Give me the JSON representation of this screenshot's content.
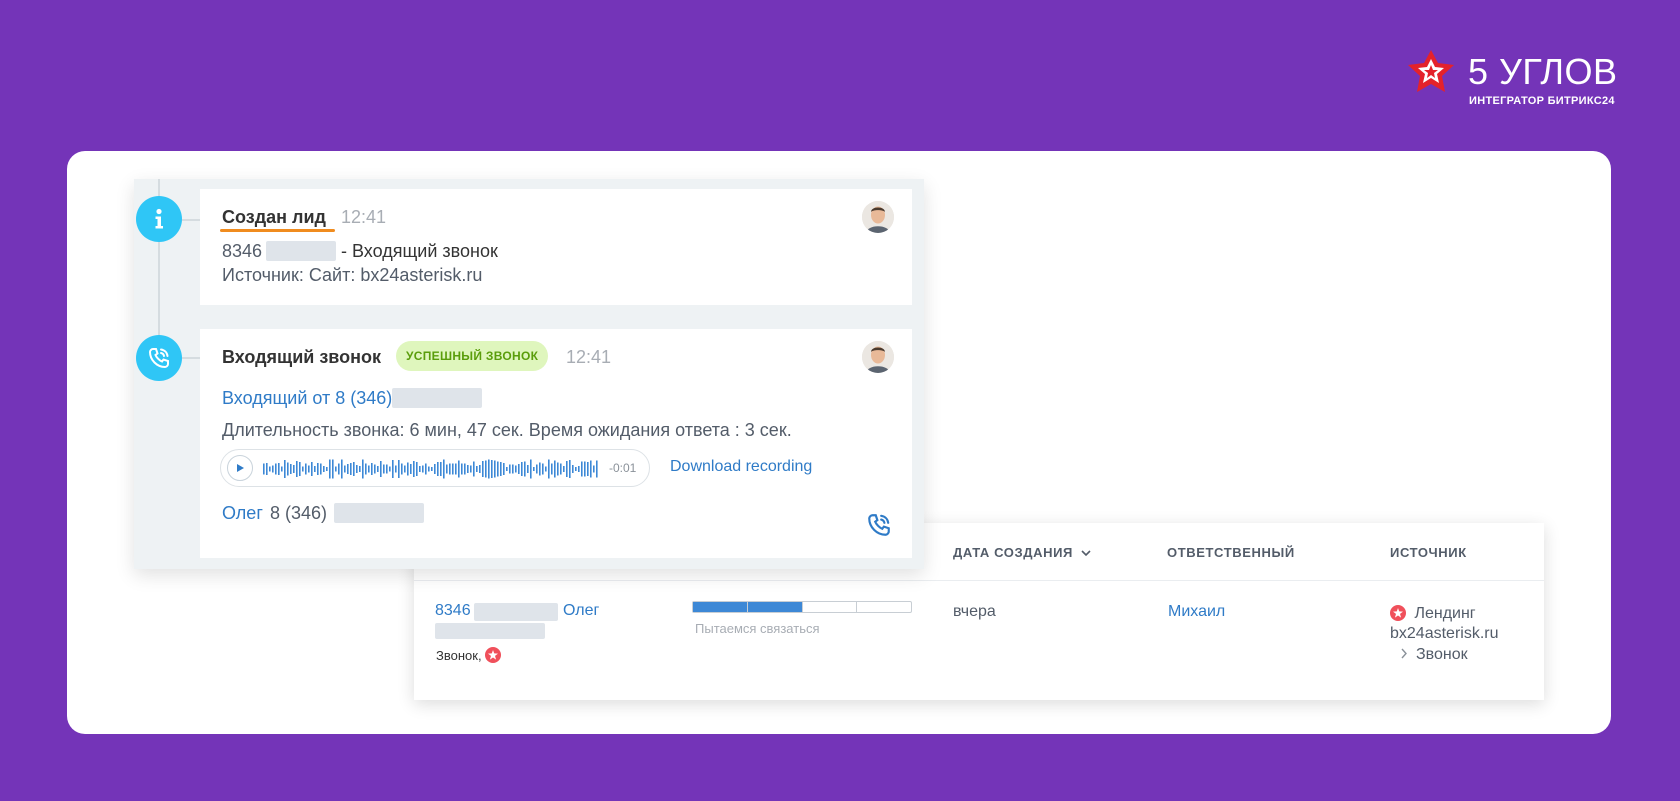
{
  "brand": {
    "name": "5 УГЛОВ",
    "subtitle": "ИНТЕГРАТОР БИТРИКС24",
    "accent": "#e4222b"
  },
  "colors": {
    "background": "#7434b8",
    "timeline_icon": "#2fc6f6",
    "link": "#2f7bc7",
    "underline": "#f08c1f",
    "badge_bg": "#dff6bd",
    "badge_text": "#5a9d0b",
    "progress_fill": "#3d88d6"
  },
  "timeline": {
    "lead_created": {
      "icon": "info-icon",
      "title": "Создан лид",
      "time": "12:41",
      "phone_prefix": "8346",
      "call_type": "- Входящий звонок",
      "source": "Источник: Сайт: bx24asterisk.ru"
    },
    "incoming_call": {
      "icon": "phone-icon",
      "title": "Входящий звонок",
      "badge": "УСПЕШНЫЙ ЗВОНОК",
      "time": "12:41",
      "from_link": "Входящий от 8 (346)",
      "duration": "Длительность звонка: 6 мин, 47 сек. Время ожидания ответа : 3 сек.",
      "player_time": "-0:01",
      "download": "Download recording",
      "contact_name": "Олег",
      "contact_phone": "8 (346)"
    }
  },
  "table": {
    "headers": {
      "created": "ДАТА СОЗДАНИЯ",
      "responsible": "ОТВЕТСТВЕННЫЙ",
      "source": "ИСТОЧНИК"
    },
    "row": {
      "phone_prefix": "8346",
      "contact": "Олег",
      "channel": "Звонок,",
      "status": "Пытаемся связаться",
      "status_progress": 0.5,
      "created": "вчера",
      "responsible": "Михаил",
      "source_name": "Лендинг",
      "source_site": "bx24asterisk.ru",
      "source_channel": "Звонок"
    }
  }
}
